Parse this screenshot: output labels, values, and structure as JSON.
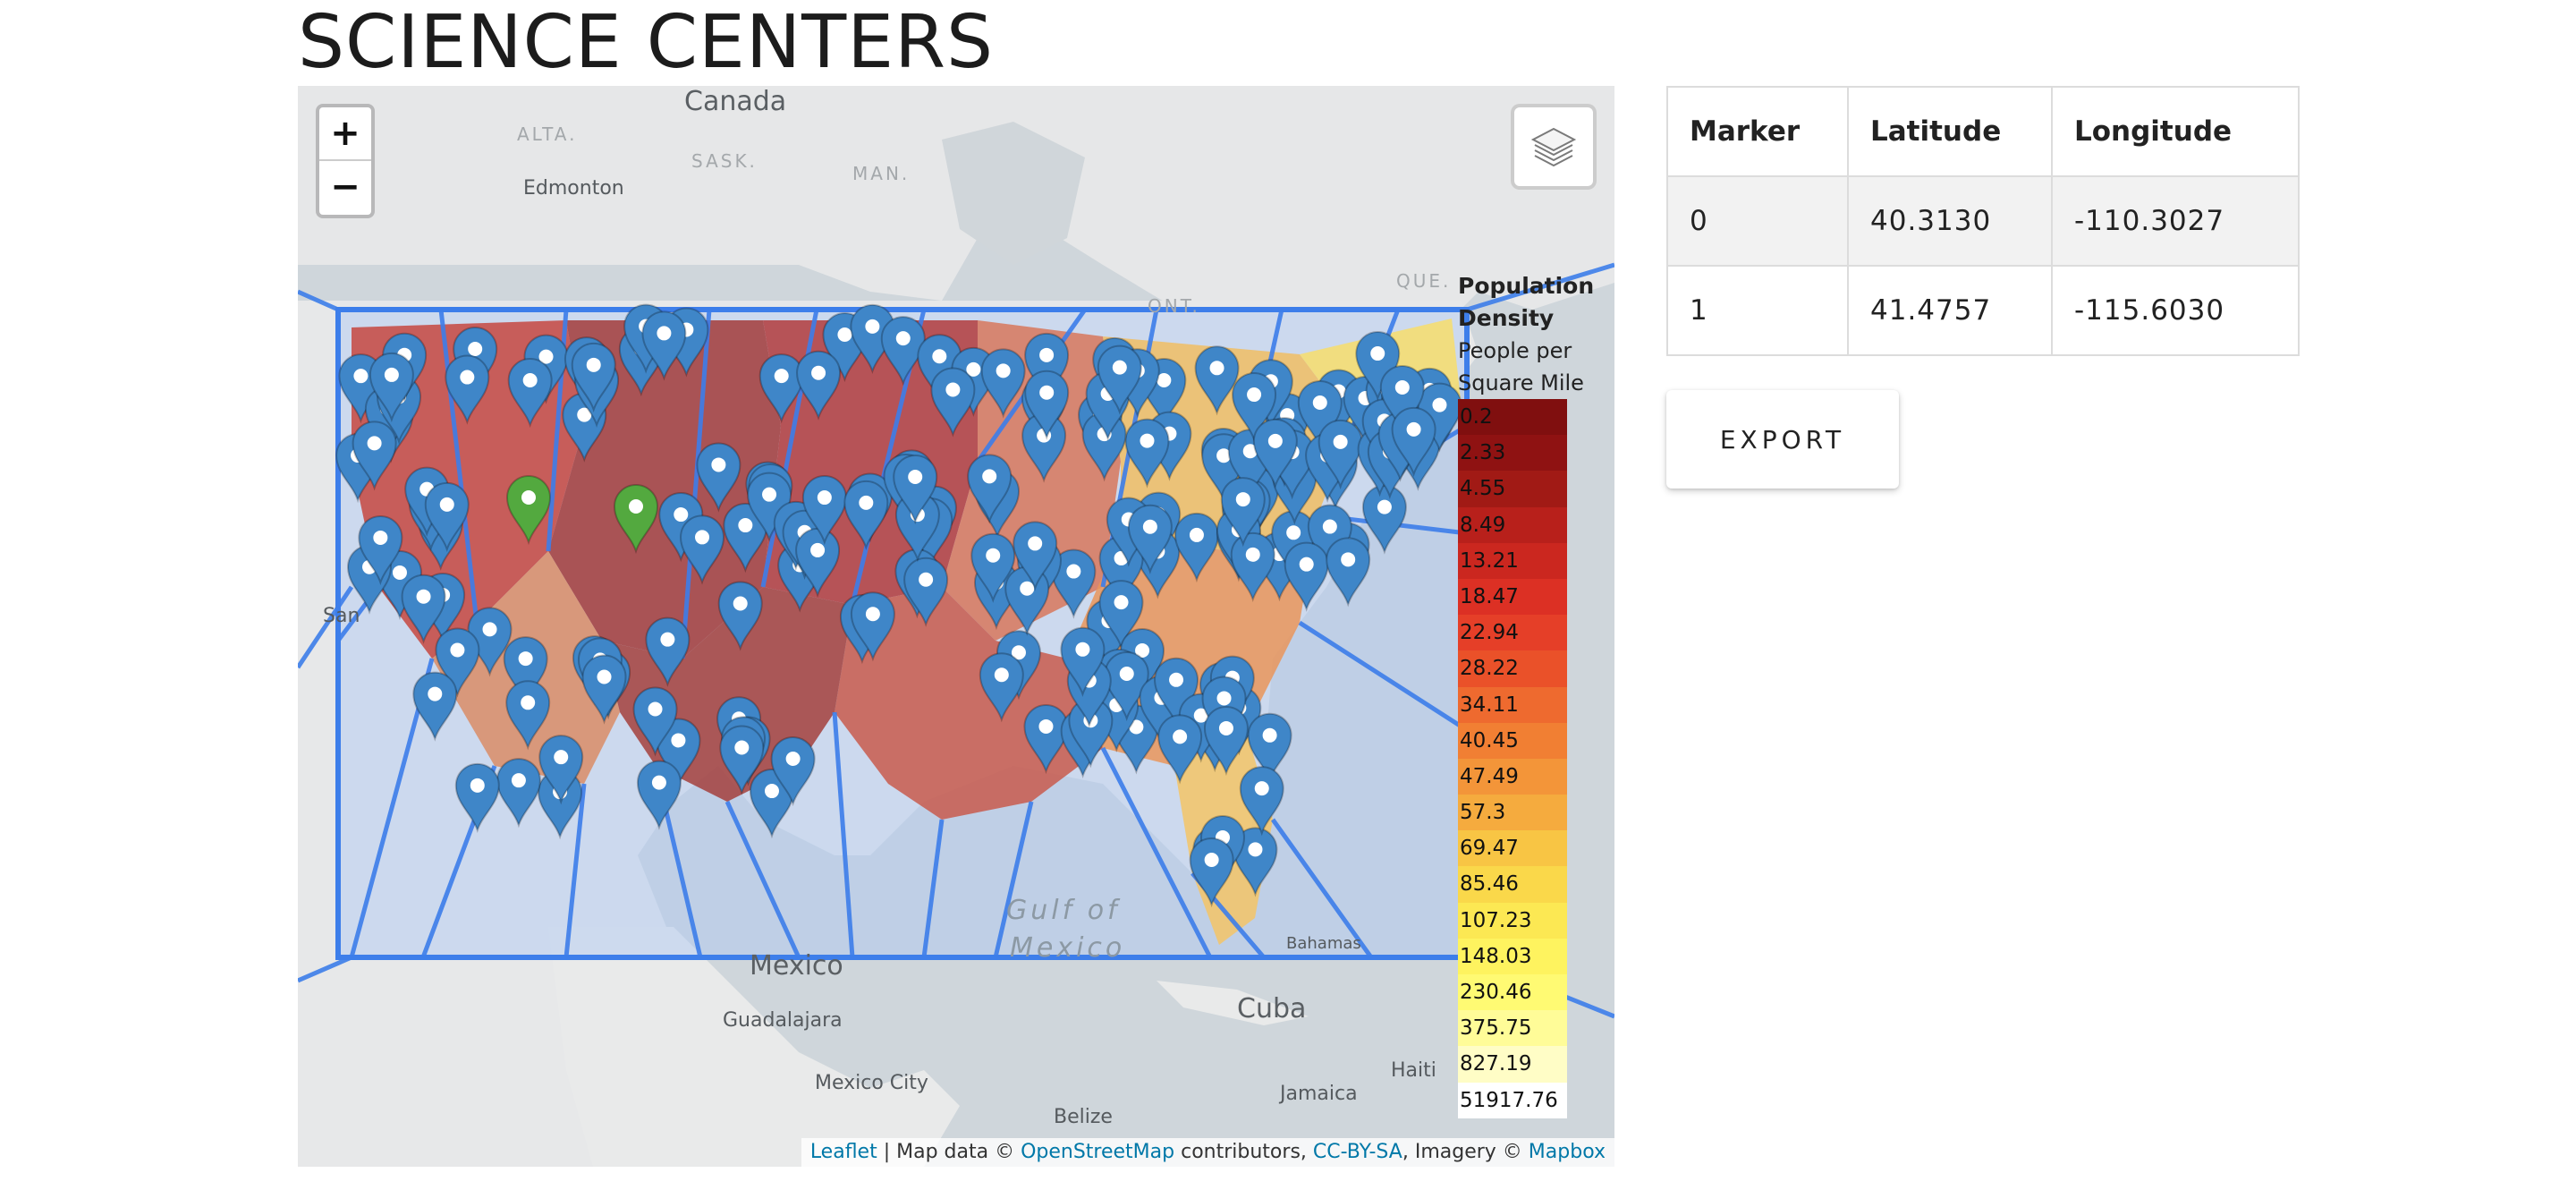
{
  "page": {
    "title": "SCIENCE CENTERS"
  },
  "map": {
    "zoom_in_label": "+",
    "zoom_out_label": "−",
    "layers_icon": "layers-icon",
    "labels": {
      "canada": "Canada",
      "alta": "ALTA.",
      "sask": "SASK.",
      "man": "MAN.",
      "ont": "ONT.",
      "que": "QUE.",
      "edmonton": "Edmonton",
      "mexico": "Mexico",
      "guadalajara": "Guadalajara",
      "mexico_city": "Mexico City",
      "cuba": "Cuba",
      "belize": "Belize",
      "jamaica": "Jamaica",
      "haiti": "Haiti",
      "bahamas": "Bahamas",
      "gulf_of": "Gulf of",
      "gulf_mexico": "Mexico",
      "san": "San"
    },
    "attribution": {
      "leaflet": "Leaflet",
      "sep": " | Map data © ",
      "osm": "OpenStreetMap",
      "contrib": " contributors, ",
      "ccbysa": "CC-BY-SA",
      "imagery": ", Imagery © ",
      "mapbox": "Mapbox"
    },
    "highlight_color": "#53a93f",
    "marker_color": "#3f86c8",
    "bbox_color": "#3d7eea"
  },
  "legend": {
    "title_line1": "Population",
    "title_line2": "Density",
    "subtitle_line1": "People per",
    "subtitle_line2": "Square Mile",
    "items": [
      {
        "label": "0.2",
        "color": "#800f0f"
      },
      {
        "label": "2.33",
        "color": "#8f1212"
      },
      {
        "label": "4.55",
        "color": "#a11a15"
      },
      {
        "label": "8.49",
        "color": "#b8201b"
      },
      {
        "label": "13.21",
        "color": "#cb271f"
      },
      {
        "label": "18.47",
        "color": "#dc3024"
      },
      {
        "label": "22.94",
        "color": "#e53f28"
      },
      {
        "label": "28.22",
        "color": "#ea5129"
      },
      {
        "label": "34.11",
        "color": "#ee6a2f"
      },
      {
        "label": "40.45",
        "color": "#f17f33"
      },
      {
        "label": "47.49",
        "color": "#f39539"
      },
      {
        "label": "57.3",
        "color": "#f5ab3e"
      },
      {
        "label": "69.47",
        "color": "#f8c544"
      },
      {
        "label": "85.46",
        "color": "#fad84a"
      },
      {
        "label": "107.23",
        "color": "#fce853"
      },
      {
        "label": "148.03",
        "color": "#fef35f"
      },
      {
        "label": "230.46",
        "color": "#fffa73"
      },
      {
        "label": "375.75",
        "color": "#fffc98"
      },
      {
        "label": "827.19",
        "color": "#fffdc6"
      },
      {
        "label": "51917.76",
        "color": "#ffffff"
      }
    ]
  },
  "table": {
    "headers": [
      "Marker",
      "Latitude",
      "Longitude"
    ],
    "rows": [
      [
        "0",
        "40.3130",
        "-110.3027"
      ],
      [
        "1",
        "41.4757",
        "-115.6030"
      ]
    ]
  },
  "export_label": "EXPORT"
}
